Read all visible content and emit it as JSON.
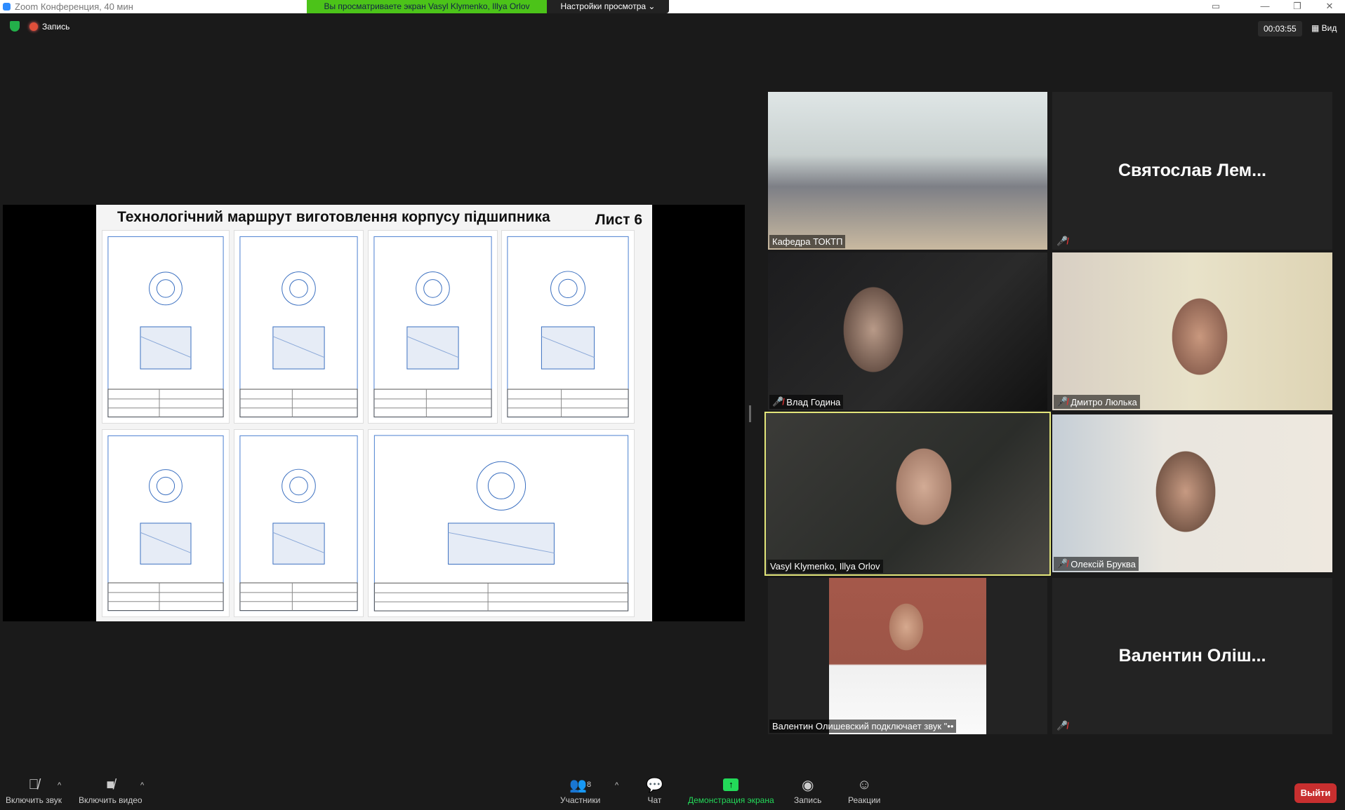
{
  "window": {
    "title": "Zoom Конференция, 40 мин",
    "banner": "Вы просматриваете экран Vasyl Klymenko, Illya Orlov",
    "view_settings": "Настройки просмотра ⌄"
  },
  "top": {
    "recording": "Запись",
    "timer": "00:03:55",
    "view": "Вид"
  },
  "slide": {
    "title": "Технологічний маршрут виготовлення корпусу підшипника",
    "sheet": "Лист 6"
  },
  "participants": [
    {
      "name": "Кафедра ТОКТП",
      "muted": false
    },
    {
      "name": "Святослав Лем...",
      "muted": true
    },
    {
      "name": "Влад Година",
      "muted": true
    },
    {
      "name": "Дмитро Люлька",
      "muted": true
    },
    {
      "name": "Vasyl Klymenko, Illya Orlov",
      "muted": false
    },
    {
      "name": "Олексій Бруква",
      "muted": true
    },
    {
      "name": "Валентин Олишевский подключает звук \"••",
      "muted": false
    },
    {
      "name": "Валентин  Оліш...",
      "muted": true
    }
  ],
  "toolbar": {
    "unmute": "Включить звук",
    "video": "Включить видео",
    "participants": "Участники",
    "participants_count": "8",
    "chat": "Чат",
    "share": "Демонстрация экрана",
    "record": "Запись",
    "reactions": "Реакции",
    "leave": "Выйти"
  },
  "colors": {
    "banner": "#4cc319",
    "share": "#23d959",
    "leave": "#c82f2f",
    "active": "#e3e67a"
  }
}
